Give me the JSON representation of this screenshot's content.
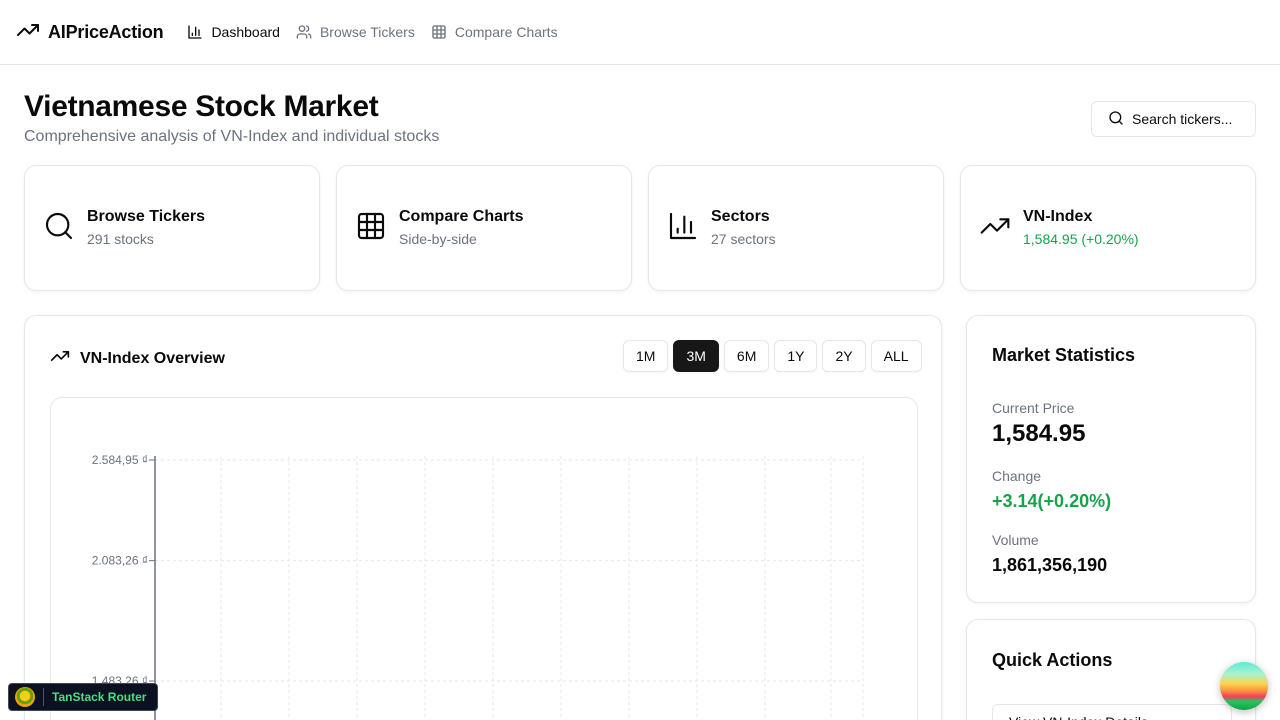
{
  "app": {
    "name": "AIPriceAction"
  },
  "nav": [
    {
      "label": "Dashboard",
      "icon": "bar-chart-icon",
      "active": true
    },
    {
      "label": "Browse Tickers",
      "icon": "users-icon",
      "active": false
    },
    {
      "label": "Compare Charts",
      "icon": "grid-icon",
      "active": false
    }
  ],
  "page": {
    "title": "Vietnamese Stock Market",
    "subtitle": "Comprehensive analysis of VN-Index and individual stocks"
  },
  "search": {
    "label": "Search tickers..."
  },
  "cards": [
    {
      "title": "Browse Tickers",
      "sub": "291 stocks",
      "icon": "search-icon"
    },
    {
      "title": "Compare Charts",
      "sub": "Side-by-side",
      "icon": "grid-icon"
    },
    {
      "title": "Sectors",
      "sub": "27 sectors",
      "icon": "bar-chart-icon"
    },
    {
      "title": "VN-Index",
      "sub": "1,584.95 (+0.20%)",
      "icon": "trending-up-icon",
      "accent": "#16a34a"
    }
  ],
  "overview": {
    "title": "VN-Index Overview",
    "ranges": [
      "1M",
      "3M",
      "6M",
      "1Y",
      "2Y",
      "ALL"
    ],
    "active_range": "3M"
  },
  "chart_data": {
    "type": "line",
    "title": "",
    "ytick_labels": [
      "2.584,95 ₫",
      "2.083,26 ₫",
      "1.483,26 ₫"
    ],
    "yticks": [
      2584.95,
      2083.26,
      1483.26
    ],
    "ylim": [
      900,
      2584.95
    ],
    "grid": true,
    "series": []
  },
  "stats": {
    "title": "Market Statistics",
    "price_label": "Current Price",
    "price": "1,584.95",
    "change_label": "Change",
    "change": "+3.14(+0.20%)",
    "volume_label": "Volume",
    "volume": "1,861,356,190",
    "positive_color": "#16a34a"
  },
  "quick": {
    "title": "Quick Actions",
    "button": "View VN-Index Details"
  },
  "devtools": {
    "label": "TanStack Router"
  }
}
